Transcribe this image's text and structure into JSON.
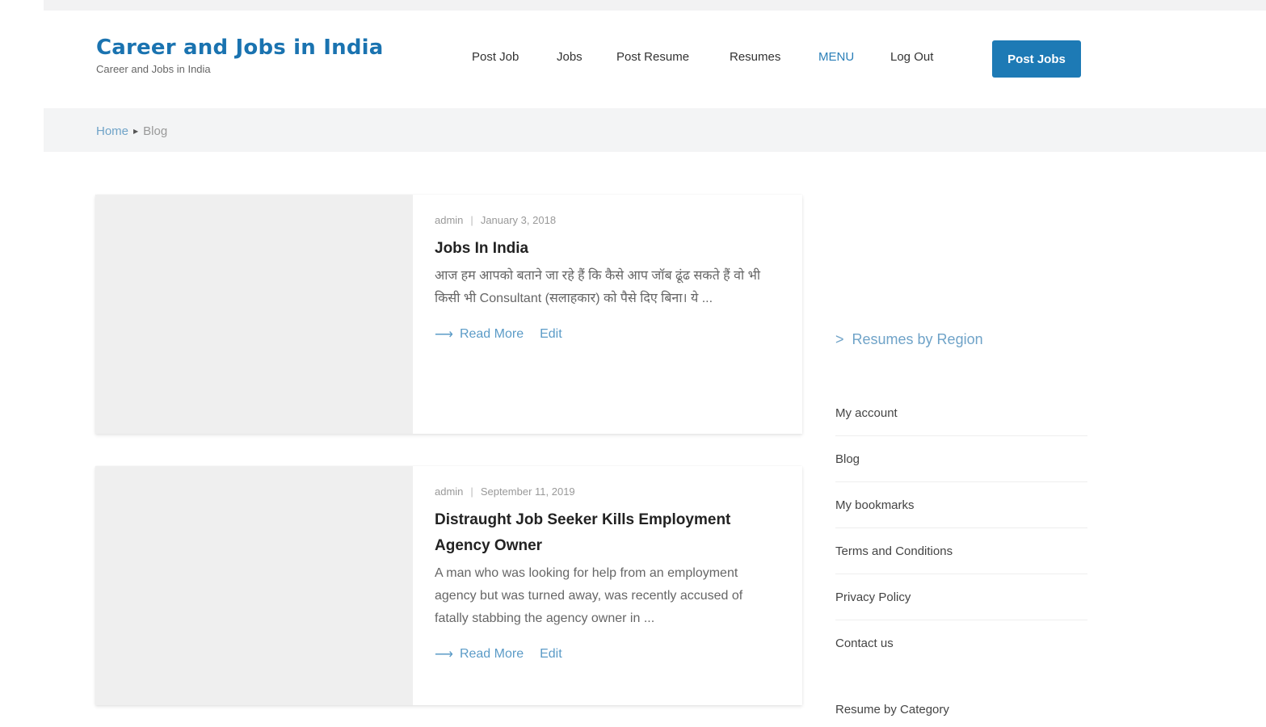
{
  "site": {
    "title": "Career and Jobs in India",
    "tagline": "Career and Jobs in India"
  },
  "nav": {
    "items": [
      {
        "label": "Post Job",
        "active": false
      },
      {
        "label": "Jobs",
        "active": false
      },
      {
        "label": "Post Resume",
        "active": false
      },
      {
        "label": "Resumes",
        "active": false
      },
      {
        "label": "MENU",
        "active": true
      },
      {
        "label": "Log Out",
        "active": false
      }
    ],
    "cta_label": "Post Jobs"
  },
  "breadcrumb": {
    "home": "Home",
    "current": "Blog"
  },
  "posts": [
    {
      "author": "admin",
      "date": "January 3, 2018",
      "title": "Jobs In India",
      "excerpt": "आज हम आपको बताने जा रहे हैं कि कैसे आप जॉब ढूंढ सकते हैं वो भी किसी भी Consultant (सलाहकार) को पैसे दिए बिना। ये ...",
      "read_more": "Read More",
      "edit": "Edit"
    },
    {
      "author": "admin",
      "date": "September 11, 2019",
      "title": "Distraught Job Seeker Kills Employment Agency Owner",
      "excerpt": "A man who was looking for help from an employment agency but was turned away, was recently accused of fatally stabbing the agency owner in ...",
      "read_more": "Read More",
      "edit": "Edit"
    }
  ],
  "sidebar": {
    "region_link": "Resumes by Region",
    "menu": [
      "My account",
      "Blog",
      "My bookmarks",
      "Terms and Conditions",
      "Privacy Policy",
      "Contact us"
    ],
    "category_heading": "Resume by Category"
  },
  "colors": {
    "brand": "#1a73b0",
    "button": "#1d7ab5",
    "link": "#5b9bc7"
  }
}
